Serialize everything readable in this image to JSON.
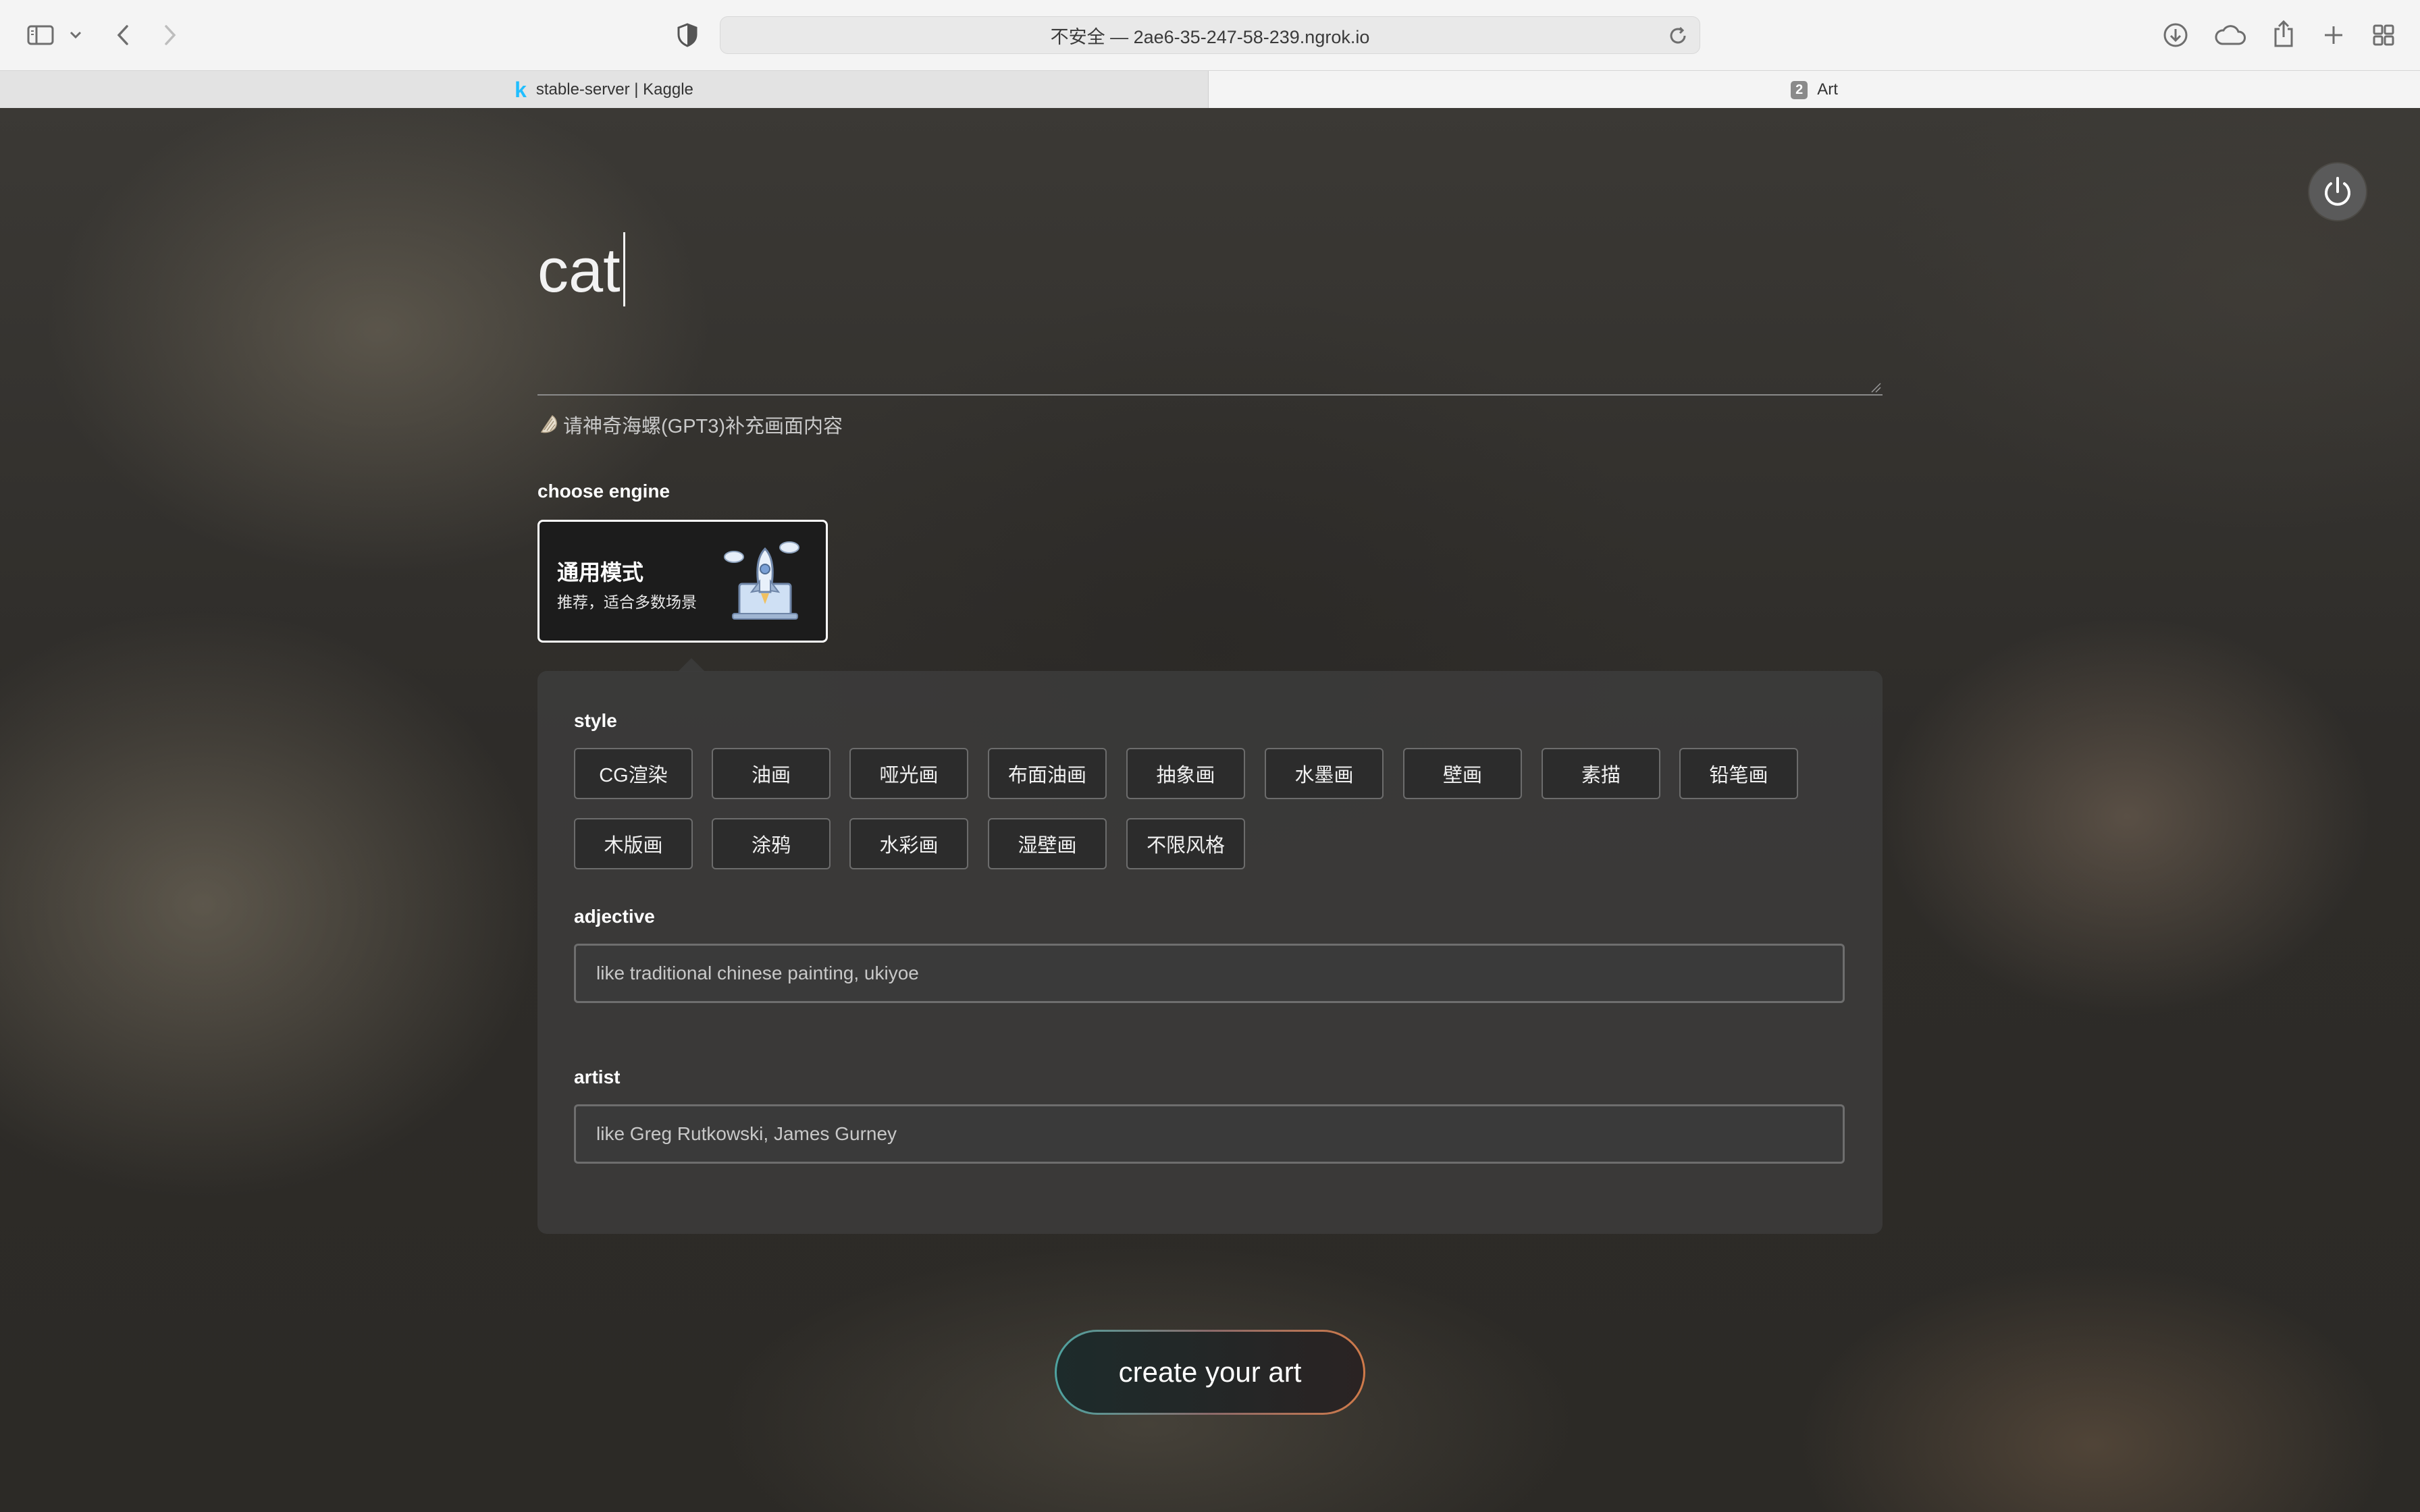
{
  "browser": {
    "url_text": "不安全 — 2ae6-35-247-58-239.ngrok.io",
    "tabs": [
      {
        "label": "stable-server | Kaggle",
        "icon": "kaggle-k-icon",
        "favicon_text": "k"
      },
      {
        "label": "Art",
        "badge": "2"
      }
    ],
    "icons": [
      "sidebar-icon",
      "chevron-down-icon",
      "back-icon",
      "forward-icon",
      "shield-icon",
      "reload-icon",
      "download-icon",
      "cloud-icon",
      "share-icon",
      "plus-icon",
      "tab-overview-icon"
    ]
  },
  "page": {
    "prompt": {
      "value": "cat"
    },
    "gpt_link": {
      "label": "请神奇海螺(GPT3)补充画面内容",
      "icon": "shell-icon"
    },
    "engine": {
      "label": "choose engine",
      "cards": [
        {
          "title": "通用模式",
          "subtitle": "推荐，适合多数场景",
          "icon": "rocket-laptop-icon"
        }
      ]
    },
    "style": {
      "label": "style",
      "options": [
        "CG渲染",
        "油画",
        "哑光画",
        "布面油画",
        "抽象画",
        "水墨画",
        "壁画",
        "素描",
        "铅笔画",
        "木版画",
        "涂鸦",
        "水彩画",
        "湿壁画",
        "不限风格"
      ]
    },
    "adjective": {
      "label": "adjective",
      "placeholder": "like traditional chinese painting, ukiyoe"
    },
    "artist": {
      "label": "artist",
      "placeholder": "like Greg Rutkowski, James Gurney"
    },
    "create_button": {
      "label": "create your art"
    },
    "power_button": {
      "icon": "power-icon"
    }
  },
  "colors": {
    "create_gradient_start": "#4ea3a0",
    "create_gradient_end": "#d07a4a",
    "kaggle_blue": "#20beff"
  }
}
